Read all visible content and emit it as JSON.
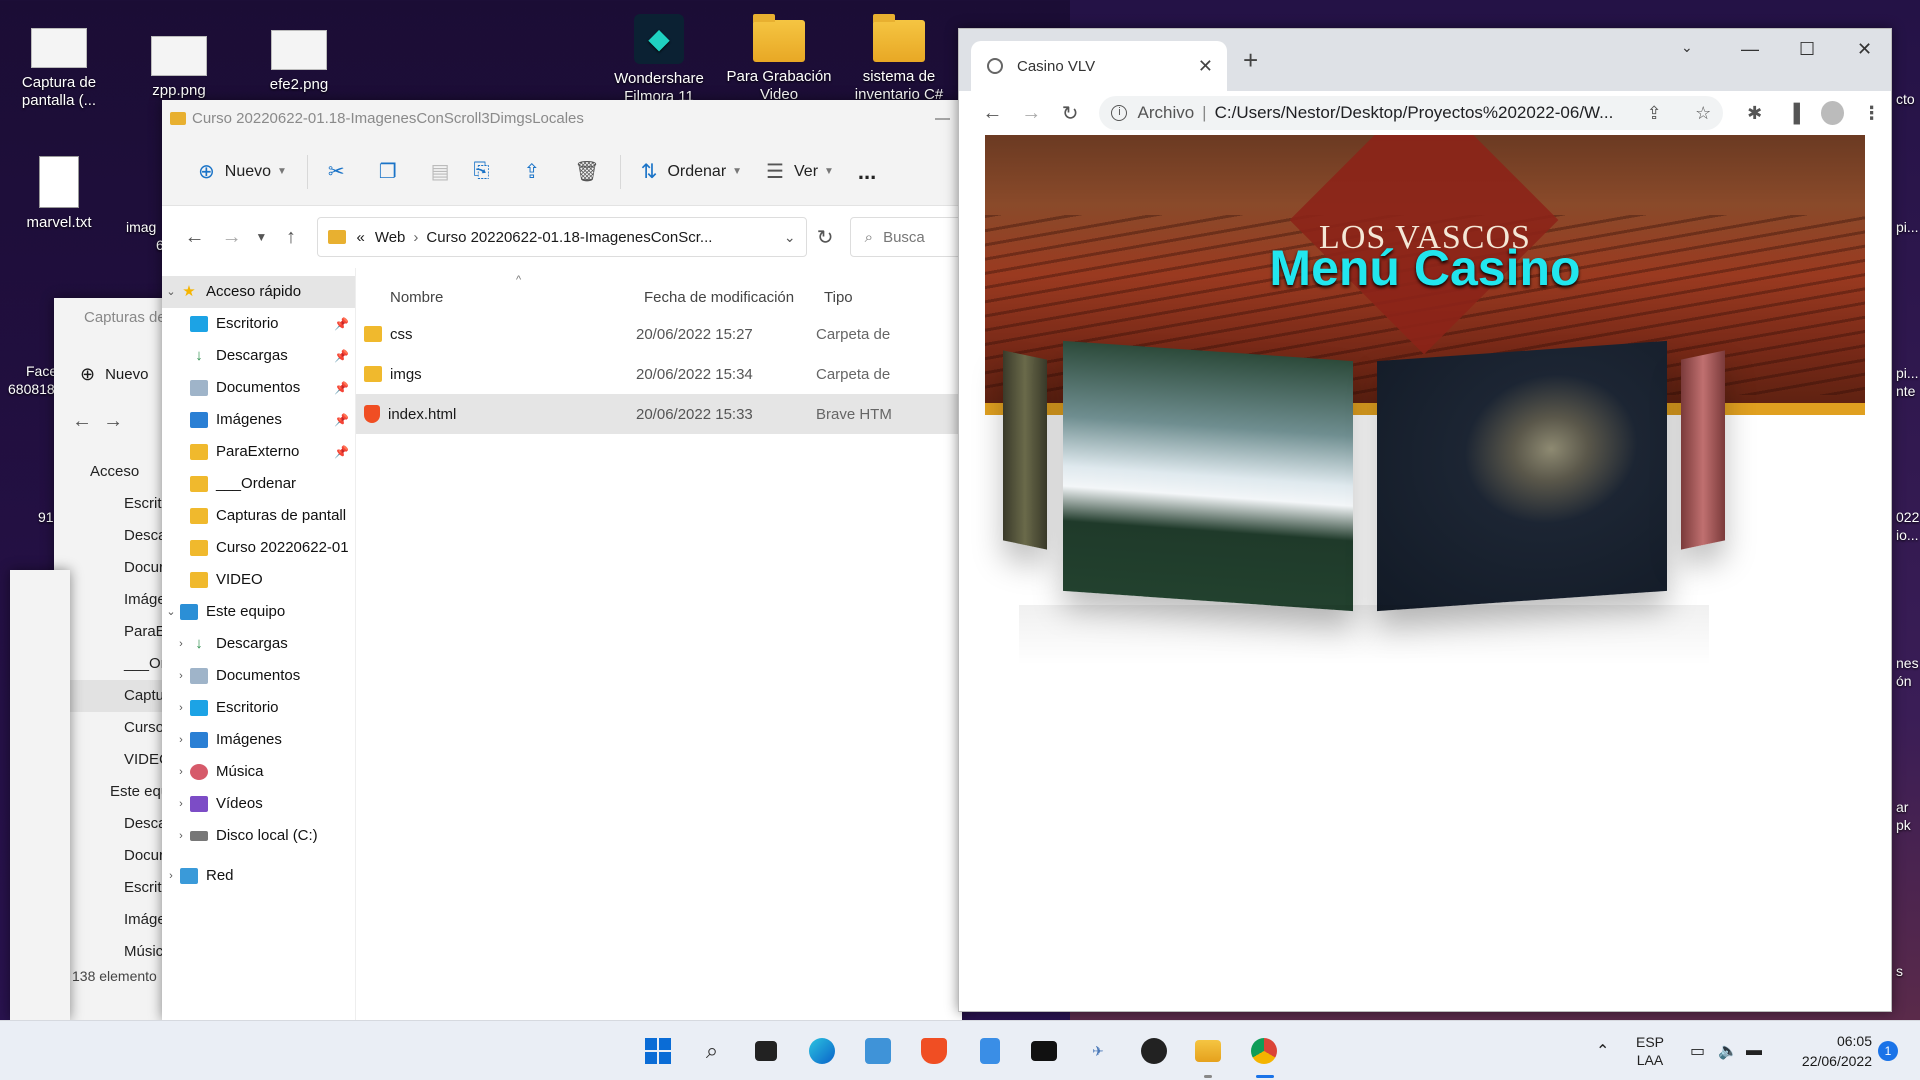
{
  "desktop": {
    "icons": [
      {
        "label": "Captura de pantalla (...",
        "kind": "thumb"
      },
      {
        "label": "zpp.png",
        "kind": "thumb"
      },
      {
        "label": "efe2.png",
        "kind": "thumb"
      },
      {
        "label": "Wondershare Filmora 11",
        "kind": "app"
      },
      {
        "label": "Para Grabación Video",
        "kind": "folder"
      },
      {
        "label": "sistema de inventario C#",
        "kind": "folder"
      },
      {
        "label": "marvel.txt",
        "kind": "doc"
      }
    ],
    "clipped_left": [
      "imag",
      "6",
      "Face",
      "680818",
      "91"
    ],
    "clipped_right": [
      "cto",
      "pi...",
      "pi...",
      "nte",
      "022",
      "io...",
      "nes",
      "ón",
      "ar",
      "pk",
      "s"
    ]
  },
  "back_explorer": {
    "title": "Capturas de",
    "new_label": "Nuevo",
    "nav": [
      "Acceso",
      "Escrito",
      "Desca",
      "Docur",
      "Imáge",
      "ParaEx",
      "___Or",
      "Captu",
      "Curso",
      "VIDEC",
      "Este equ",
      "Desca",
      "Docur",
      "Escrito",
      "Imáge",
      "Música"
    ],
    "status": "138 elemento"
  },
  "explorer": {
    "title": "Curso 20220622-01.18-ImagenesConScroll3DimgsLocales",
    "toolbar": {
      "new": "Nuevo",
      "sort": "Ordenar",
      "view": "Ver",
      "more": "..."
    },
    "address": {
      "prefix": "«",
      "parts": [
        "Web",
        "Curso 20220622-01.18-ImagenesConScr..."
      ]
    },
    "search_placeholder": "Busca",
    "nav": {
      "quick_access": "Acceso rápido",
      "quick_items": [
        "Escritorio",
        "Descargas",
        "Documentos",
        "Imágenes",
        "ParaExterno",
        "___Ordenar",
        "Capturas de pantall",
        "Curso 20220622-01",
        "VIDEO"
      ],
      "this_pc": "Este equipo",
      "pc_items": [
        "Descargas",
        "Documentos",
        "Escritorio",
        "Imágenes",
        "Música",
        "Vídeos",
        "Disco local (C:)"
      ],
      "network": "Red"
    },
    "columns": {
      "name": "Nombre",
      "date": "Fecha de modificación",
      "type": "Tipo"
    },
    "files": [
      {
        "name": "css",
        "date": "20/06/2022 15:27",
        "type": "Carpeta de",
        "icon": "folder-icon"
      },
      {
        "name": "imgs",
        "date": "20/06/2022 15:34",
        "type": "Carpeta de",
        "icon": "folder-icon"
      },
      {
        "name": "index.html",
        "date": "20/06/2022 15:33",
        "type": "Brave HTM",
        "icon": "brave-icon"
      }
    ]
  },
  "browser": {
    "tab_title": "Casino VLV",
    "url_prefix": "Archivo",
    "url": "C:/Users/Nestor/Desktop/Proyectos%202022-06/W...",
    "page": {
      "brand": "LOS VASCOS",
      "title": "Menú Casino"
    }
  },
  "taskbar": {
    "lang": "ESP",
    "region": "LAA",
    "time": "06:05",
    "date": "22/06/2022",
    "notifications": "1"
  }
}
